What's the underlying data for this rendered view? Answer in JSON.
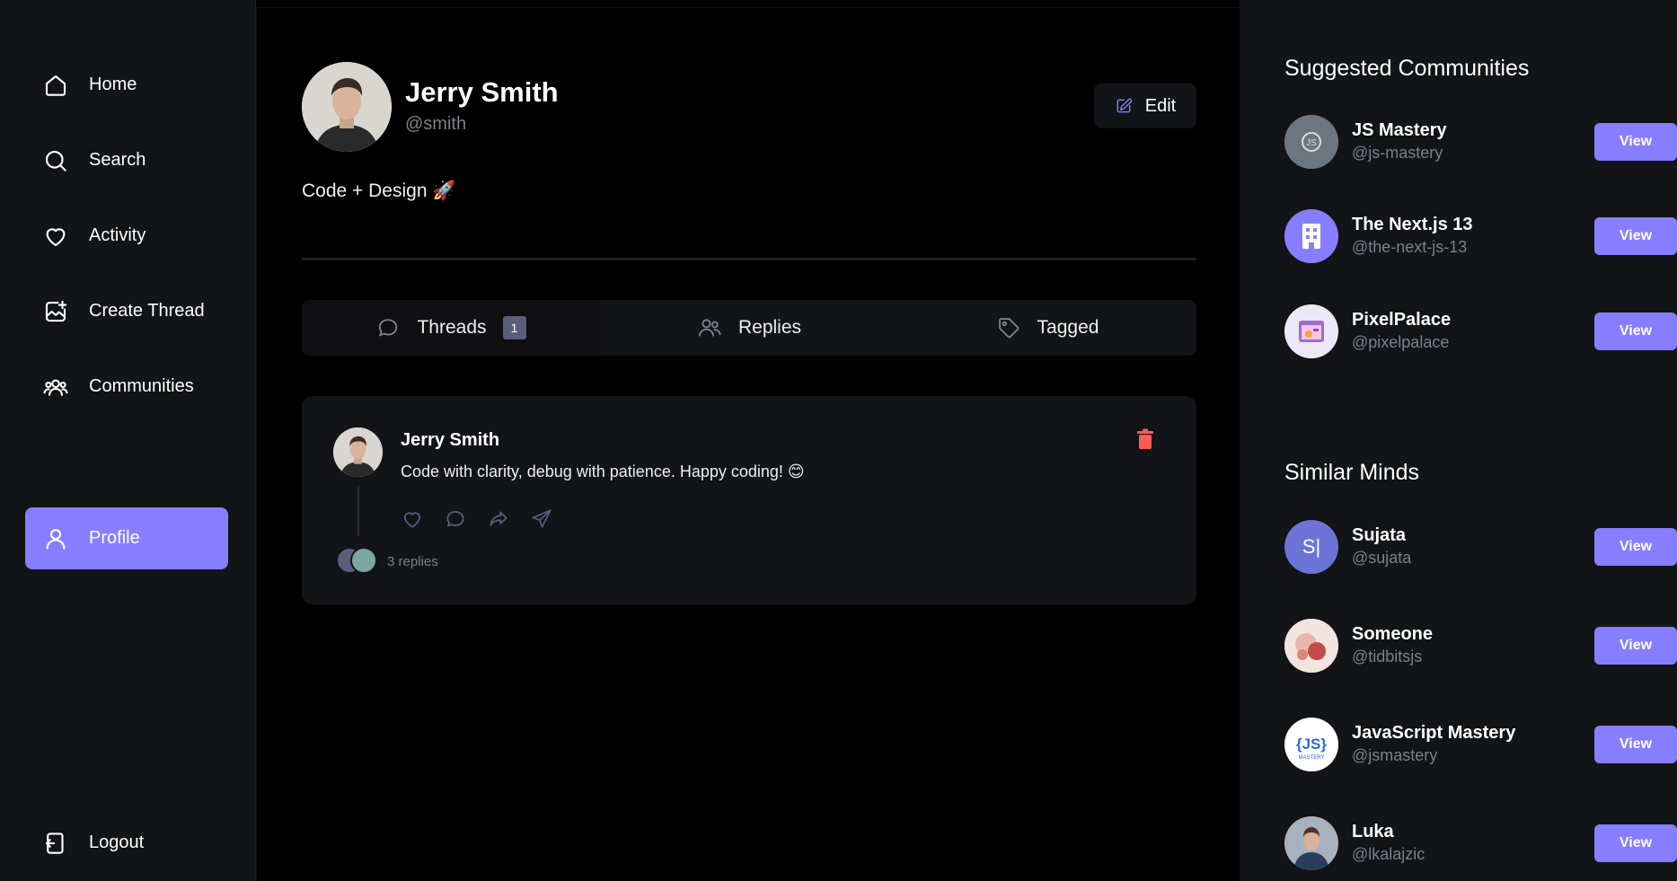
{
  "sidebar": {
    "items": [
      {
        "label": "Home",
        "icon": "home-icon"
      },
      {
        "label": "Search",
        "icon": "search-icon"
      },
      {
        "label": "Activity",
        "icon": "heart-icon"
      },
      {
        "label": "Create Thread",
        "icon": "create-thread-icon"
      },
      {
        "label": "Communities",
        "icon": "communities-icon"
      },
      {
        "label": "Profile",
        "icon": "user-icon",
        "active": true
      }
    ],
    "logout": {
      "label": "Logout",
      "icon": "logout-icon"
    }
  },
  "profile": {
    "name": "Jerry Smith",
    "handle": "@smith",
    "bio": "Code + Design 🚀",
    "edit_label": "Edit"
  },
  "tabs": [
    {
      "label": "Threads",
      "count": "1",
      "icon": "chat-bubble-icon"
    },
    {
      "label": "Replies",
      "icon": "members-icon"
    },
    {
      "label": "Tagged",
      "icon": "tag-icon"
    }
  ],
  "thread": {
    "author": "Jerry Smith",
    "text": "Code with clarity, debug with patience. Happy coding! 😊",
    "replies": "3 replies"
  },
  "suggested_communities": {
    "title": "Suggested Communities",
    "items": [
      {
        "name": "JS Mastery",
        "handle": "@js-mastery"
      },
      {
        "name": "The Next.js 13",
        "handle": "@the-next-js-13"
      },
      {
        "name": "PixelPalace",
        "handle": "@pixelpalace"
      }
    ]
  },
  "similar_minds": {
    "title": "Similar Minds",
    "items": [
      {
        "name": "Sujata",
        "handle": "@sujata",
        "initial": "S|"
      },
      {
        "name": "Someone",
        "handle": "@tidbitsjs"
      },
      {
        "name": "JavaScript Mastery",
        "handle": "@jsmastery"
      },
      {
        "name": "Luka",
        "handle": "@lkalajzic"
      }
    ]
  },
  "view_label": "View",
  "colors": {
    "accent": "#877eff",
    "panel": "#121417",
    "muted": "#7d7f8c",
    "delete": "#ff5a5a"
  }
}
